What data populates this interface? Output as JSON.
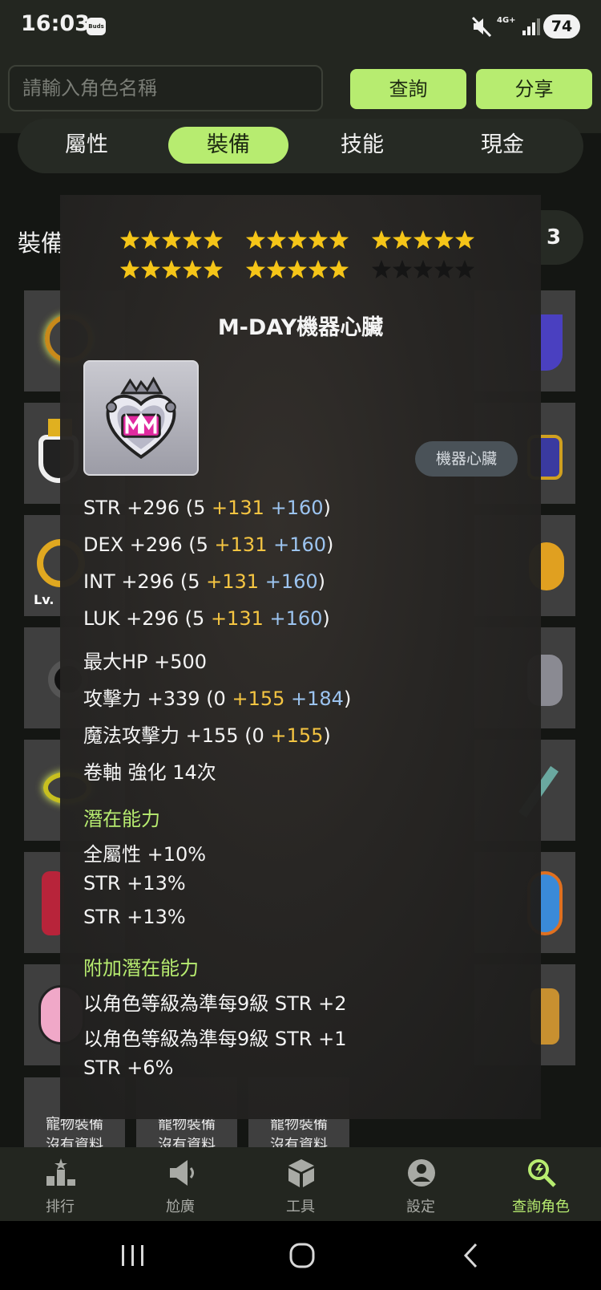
{
  "status_bar": {
    "time": "16:03",
    "buds": "Buds",
    "network": "4G+",
    "battery": "74"
  },
  "search": {
    "placeholder": "請輸入角色名稱",
    "value": ""
  },
  "header": {
    "query_label": "查詢",
    "share_label": "分享"
  },
  "tabs": [
    {
      "label": "屬性",
      "active": false
    },
    {
      "label": "裝備",
      "active": true
    },
    {
      "label": "技能",
      "active": false
    },
    {
      "label": "現金",
      "active": false
    }
  ],
  "background": {
    "section_title": "裝備",
    "pill_text": "3",
    "level_label": "Lv.",
    "pet_slots": [
      {
        "line1": "寵物裝備",
        "line2": "沒有資料"
      },
      {
        "line1": "寵物裝備",
        "line2": "沒有資料"
      },
      {
        "line1": "寵物裝備",
        "line2": "沒有資料"
      }
    ]
  },
  "item": {
    "star_force": {
      "filled": 25,
      "total": 30
    },
    "name": "M-DAY機器心臟",
    "category": "機器心臟",
    "stats": {
      "str": {
        "label": "STR +296 (5",
        "scroll": "+131",
        "bonus": "+160",
        "close": ")"
      },
      "dex": {
        "label": "DEX +296 (5",
        "scroll": "+131",
        "bonus": "+160",
        "close": ")"
      },
      "int": {
        "label": "INT +296 (5",
        "scroll": "+131",
        "bonus": "+160",
        "close": ")"
      },
      "luk": {
        "label": "LUK +296 (5",
        "scroll": "+131",
        "bonus": "+160",
        "close": ")"
      },
      "hp": {
        "label": "最大HP +500"
      },
      "atk": {
        "label": "攻擊力 +339",
        "base": "(0",
        "scroll": "+155",
        "bonus": "+184",
        "close": ")"
      },
      "matk": {
        "label": "魔法攻擊力 +155",
        "base": "(0",
        "scroll": "+155",
        "close": ")"
      },
      "upgrade": "卷軸 強化 14次"
    },
    "potential": {
      "title": "潛在能力",
      "lines": [
        "全屬性 +10%",
        "STR +13%",
        "STR +13%"
      ]
    },
    "additional_potential": {
      "title": "附加潛在能力",
      "lines": [
        "以角色等級為準每9級 STR +2",
        "以角色等級為準每9級 STR +1",
        "STR +6%"
      ]
    }
  },
  "bottom_nav": [
    {
      "label": "排行",
      "icon": "ranking-icon",
      "active": false
    },
    {
      "label": "尬廣",
      "icon": "megaphone-icon",
      "active": false
    },
    {
      "label": "工具",
      "icon": "box-icon",
      "active": false
    },
    {
      "label": "設定",
      "icon": "account-icon",
      "active": false
    },
    {
      "label": "查詢角色",
      "icon": "search-character-icon",
      "active": true
    }
  ],
  "colors": {
    "accent": "#b7ec70",
    "star_filled": "#f5c518",
    "star_empty": "#151515",
    "scroll_bonus": "#f5c542",
    "flame_bonus": "#9cc4f0"
  }
}
